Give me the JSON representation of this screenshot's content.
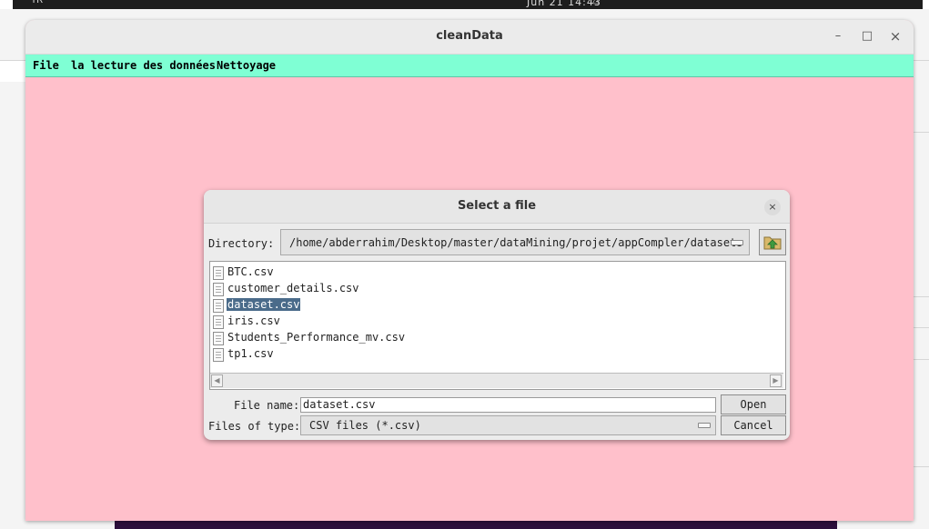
{
  "topbar": {
    "clock": "Jun 21 14:43",
    "indicator": "TR"
  },
  "window": {
    "title": "cleanData",
    "minimize_glyph": "–",
    "maximize_glyph": "□",
    "close_glyph": "×"
  },
  "menubar": {
    "items": [
      {
        "label": "File"
      },
      {
        "label": "la lecture des données"
      },
      {
        "label": "Nettoyage"
      }
    ]
  },
  "dialog": {
    "title": "Select a file",
    "close_glyph": "×",
    "directory_label": "Directory:",
    "directory_value": "/home/abderrahim/Desktop/master/dataMining/projet/appCompler/datasets",
    "up_icon": "folder-up-icon",
    "files": [
      {
        "name": "BTC.csv",
        "selected": false
      },
      {
        "name": "customer_details.csv",
        "selected": false
      },
      {
        "name": "dataset.csv",
        "selected": true
      },
      {
        "name": "iris.csv",
        "selected": false
      },
      {
        "name": "Students_Performance_mv.csv",
        "selected": false
      },
      {
        "name": "tp1.csv",
        "selected": false
      }
    ],
    "file_name_label": "File name:",
    "file_name_value": "dataset.csv",
    "open_label": "Open",
    "files_of_type_label": "Files of type:",
    "files_of_type_value": "CSV files (*.csv)",
    "cancel_label": "Cancel"
  },
  "colors": {
    "window_bg": "#ffc0cb",
    "menubar_bg": "#7fffd4",
    "selection": "#4a6b8a"
  }
}
